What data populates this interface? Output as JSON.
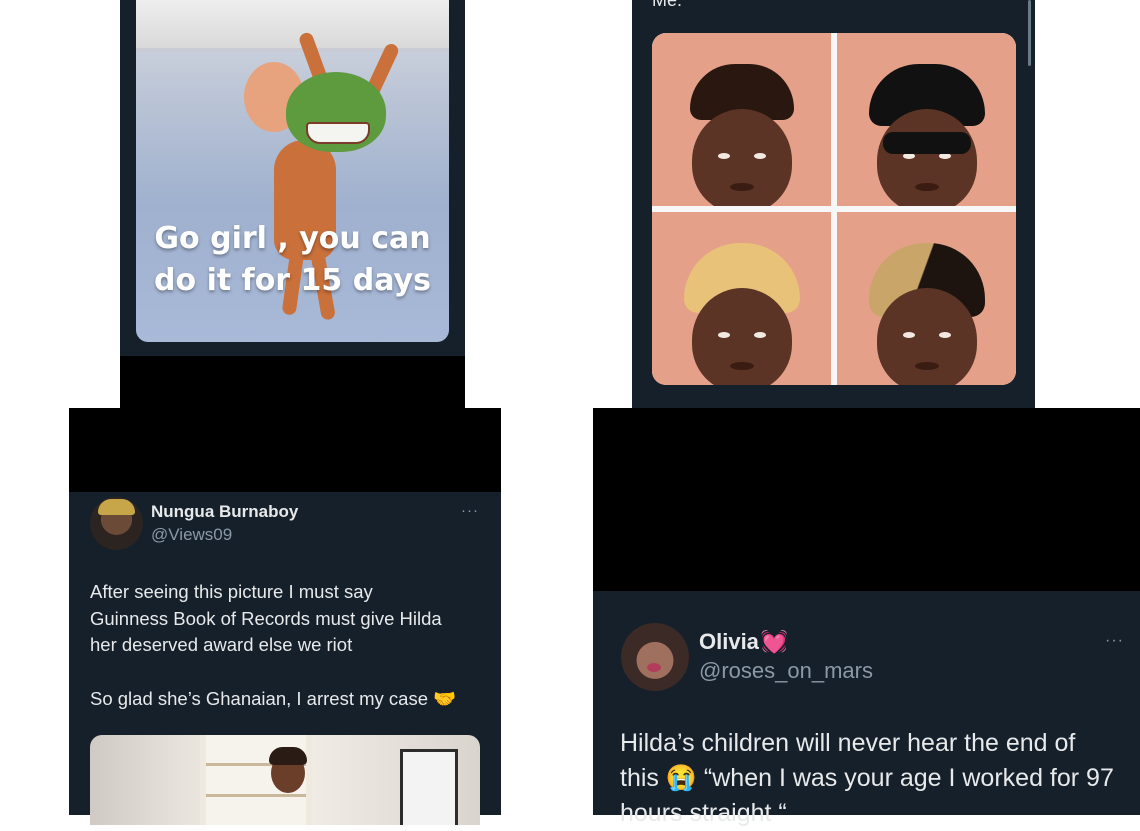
{
  "meme_panel": {
    "caption_line1": "Go girl , you can",
    "caption_line2": "do it for 15 days"
  },
  "faces_panel": {
    "top_text": "Me:"
  },
  "tweet_nungua": {
    "display_name": "Nungua Burnaboy",
    "handle": "@Views09",
    "more_icon": "···",
    "text_line1": "After seeing this picture I must say",
    "text_line2": "Guinness Book of Records must give Hilda",
    "text_line3": "her deserved award else we riot",
    "text_line4": "So glad she’s Ghanaian, I arrest my case 🤝"
  },
  "tweet_olivia": {
    "display_name": "Olivia",
    "name_emoji": "💓",
    "handle": "@roses_on_mars",
    "more_icon": "···",
    "text_line1": "Hilda’s children will never hear the end of",
    "text_line2": "this 😭 “when I was your age I worked for 97",
    "text_line3": "hours straight “"
  },
  "colors": {
    "panel_bg": "#15202b",
    "text_primary": "#e7e9ea",
    "text_secondary": "#8b98a5",
    "heart_pink": "#ff4fa3"
  }
}
